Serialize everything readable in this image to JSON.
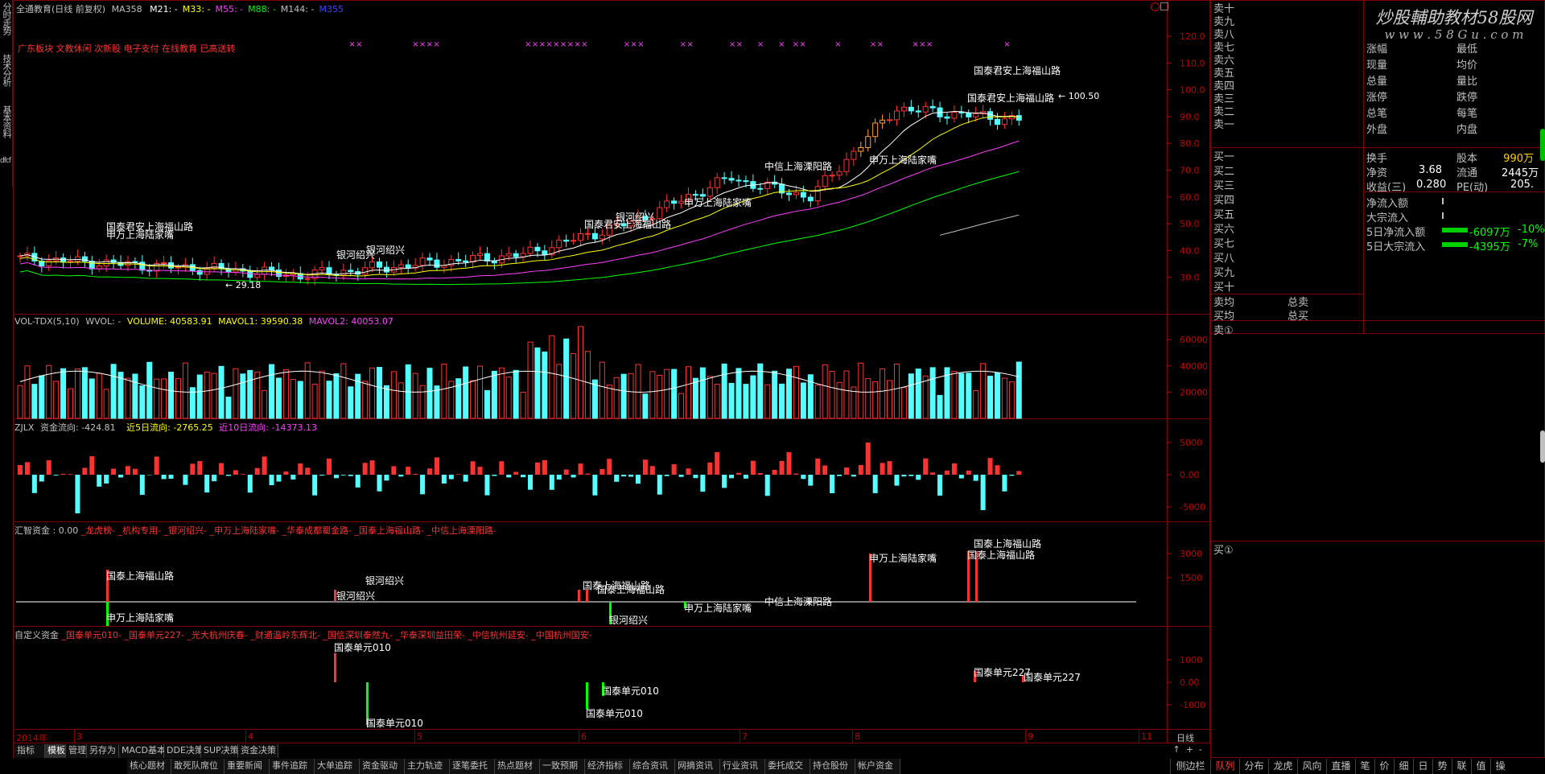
{
  "side_tabs": [
    "分时走势",
    "技术分析",
    "基本资料",
    "dfcf"
  ],
  "chart_header": {
    "stock": "全通教育(日线 前复权)",
    "ma_prefix": "MA358",
    "ma": [
      {
        "label": "M21: -",
        "color": "#ffffff"
      },
      {
        "label": "M33: -",
        "color": "#ffff00"
      },
      {
        "label": "M55: -",
        "color": "#ff40ff"
      },
      {
        "label": "M88: -",
        "color": "#00ff00"
      },
      {
        "label": "M144: -",
        "color": "#c0c0c0"
      },
      {
        "label": "M355",
        "color": "#4040ff"
      }
    ]
  },
  "concepts": "广东板块 文教休闲 次新股 电子支付 在线教育 已高送转",
  "price_axis": [
    "120.0",
    "110.0",
    "100.0",
    "90.0",
    "80.0",
    "70.0",
    "60.0",
    "50.0",
    "40.0",
    "30.0"
  ],
  "high_label": "100.50",
  "low_label": "29.18",
  "price_annotations": [
    {
      "t": "国泰君安上海福山路"
    },
    {
      "t": "国泰君安上海福山路"
    },
    {
      "t": "中信上海溧阳路"
    },
    {
      "t": "申万上海陆家嘴"
    },
    {
      "t": "申万上海陆家嘴"
    },
    {
      "t": "国泰君安上海福山路"
    },
    {
      "t": "银河绍兴"
    },
    {
      "t": "国泰君安上海福山路"
    },
    {
      "t": "申万上海陆家嘴"
    },
    {
      "t": "银河绍兴"
    },
    {
      "t": "银河绍兴"
    }
  ],
  "vol_panel": {
    "title": "VOL-TDX(5,10)",
    "wvol": "WVOL: -",
    "volume": "VOLUME: 40583.91",
    "mavol1": "MAVOL1: 39590.38",
    "mavol2": "MAVOL2: 40053.07",
    "axis": [
      "60000",
      "40000",
      "20000"
    ]
  },
  "zjlx_panel": {
    "title": "ZJLX",
    "flow": "资金流向: -424.81",
    "d5": "近5日流向: -2765.25",
    "d10": "近10日流向: -14373.13",
    "axis": [
      "5000",
      "0.00",
      "-5000"
    ]
  },
  "hz_panel": {
    "title": "汇智资金 : 0.00",
    "tags": [
      "_龙虎榜-",
      "_机构专用-",
      "_银河绍兴-",
      "_申万上海陆家嘴-",
      "_华泰成都蜀金路-",
      "_国泰上海福山路-",
      "_中信上海溧阳路-"
    ],
    "axis": [
      "3000",
      "1500"
    ],
    "labels": [
      "国泰上海福山路",
      "申万上海陆家嘴",
      "银河绍兴",
      "银河绍兴",
      "国泰上海福山路",
      "国泰上海福山路",
      "申万上海陆家嘴",
      "中信上海溧阳路",
      "申万上海陆家嘴",
      "国泰上海福山路",
      "国泰上海福山路",
      "银河绍兴"
    ]
  },
  "zdy_panel": {
    "title": "自定义资金",
    "tags": [
      "_国泰单元010-",
      "_国泰单元227-",
      "_光大杭州庆春-",
      "_财通温岭东辉北-",
      "_国信深圳泰然九-",
      "_华泰深圳益田荣-",
      "_中信杭州延安-",
      "_中国杭州国安-"
    ],
    "axis": [
      "1000",
      "0.00",
      "-1000"
    ],
    "labels": [
      "国泰单元010",
      "国泰单元010",
      "国泰单元010",
      "国泰单元010",
      "国泰单元227",
      "国泰单元227"
    ]
  },
  "time_axis": {
    "year": "2014年",
    "months": [
      "3",
      "4",
      "5",
      "6",
      "7",
      "8",
      "9",
      "11"
    ],
    "period": "日线"
  },
  "bottom_tabs": [
    "指标",
    "模板",
    "管理",
    "另存为",
    "MACD基本",
    "DDE决策",
    "SUP决策",
    "资金决策"
  ],
  "func_tabs": [
    "核心题材",
    "敢死队席位",
    "重要新闻",
    "事件追踪",
    "大单追踪",
    "资金驱动",
    "主力轨迹",
    "逐笔委托",
    "热点题材",
    "一致预期",
    "经济指标",
    "综合资讯",
    "网摘资讯",
    "行业资讯",
    "委托成交",
    "持仓股份",
    "帐户资金"
  ],
  "order_book": {
    "sell": [
      "卖十",
      "卖九",
      "卖八",
      "卖七",
      "卖六",
      "卖五",
      "卖四",
      "卖三",
      "卖二",
      "卖一"
    ],
    "buy": [
      "买一",
      "买二",
      "买三",
      "买四",
      "买五",
      "买六",
      "买七",
      "买八",
      "买九",
      "买十"
    ],
    "sell_avg": "卖均",
    "buy_avg": "买均",
    "total_sell": "总卖",
    "total_buy": "总买",
    "sell1_queue": "卖①",
    "buy1_queue": "买①"
  },
  "watermark": "炒股輔助教材58股网",
  "watermark_url": "w w w . 5 8 G u . c o m",
  "quote": [
    [
      "涨幅",
      "",
      "最低",
      ""
    ],
    [
      "现量",
      "",
      "均价",
      ""
    ],
    [
      "总量",
      "",
      "量比",
      ""
    ],
    [
      "涨停",
      "",
      "跌停",
      ""
    ],
    [
      "总笔",
      "",
      "每笔",
      ""
    ],
    [
      "外盘",
      "",
      "内盘",
      ""
    ]
  ],
  "quote2": [
    [
      "换手",
      "",
      "股本",
      "990万"
    ],
    [
      "净资",
      "3.68",
      "流通",
      "2445万"
    ],
    [
      "收益(三)",
      "0.280",
      "PE(动)",
      "205."
    ]
  ],
  "flows": [
    {
      "label": "净流入额",
      "val": "",
      "pct": ""
    },
    {
      "label": "大宗流入",
      "val": "",
      "pct": ""
    },
    {
      "label": "5日净流入额",
      "val": "-6097万",
      "pct": "-10%"
    },
    {
      "label": "5日大宗流入",
      "val": "-4395万",
      "pct": "-7%"
    }
  ],
  "period_label": "日线",
  "right_tabs": [
    "侧边栏",
    "队列",
    "分布",
    "龙虎",
    "风向",
    "直播",
    "笔",
    "价",
    "细",
    "日",
    "势",
    "联",
    "值",
    "操"
  ],
  "colors": {
    "up": "#ff3232",
    "down": "#54ffff",
    "frame": "#800000",
    "axis": "#c00000"
  }
}
